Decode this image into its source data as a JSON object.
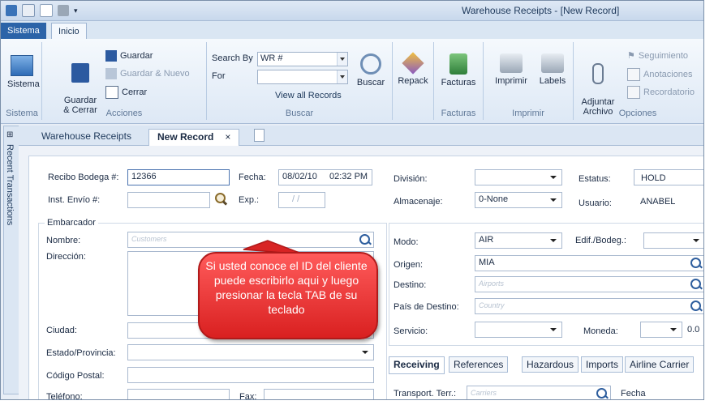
{
  "window": {
    "title": "Warehouse Receipts - [New Record]"
  },
  "ribbon_tabs": {
    "app": "Sistema",
    "home": "Inicio"
  },
  "ribbon": {
    "groups": {
      "sistema": {
        "label": "Sistema",
        "btn": "Sistema"
      },
      "acciones": {
        "label": "Acciones",
        "guardar_cerrar": "Guardar\n& Cerrar",
        "guardar": "Guardar",
        "guardar_nuevo": "Guardar & Nuevo",
        "cerrar": "Cerrar"
      },
      "buscar": {
        "label": "Buscar",
        "search_by_label": "Search By",
        "search_by_value": "WR #",
        "for_label": "For",
        "view_all": "View all Records",
        "buscar_btn": "Buscar"
      },
      "repack": {
        "btn": "Repack"
      },
      "facturas": {
        "label": "Facturas",
        "btn": "Facturas"
      },
      "imprimir": {
        "label": "Imprimir",
        "imprimir_btn": "Imprimir",
        "labels_btn": "Labels"
      },
      "opciones": {
        "label": "Opciones",
        "adjuntar": "Adjuntar\nArchivo",
        "seguimiento": "Seguimiento",
        "anotaciones": "Anotaciones",
        "recordatorio": "Recordatorio"
      }
    }
  },
  "sidebar": {
    "recent": "Recent Transactions"
  },
  "doc_tabs": {
    "warehouse": "Warehouse Receipts",
    "new_record": "New Record",
    "close": "×"
  },
  "form": {
    "recibo_label": "Recibo Bodega #:",
    "recibo_value": "12366",
    "fecha_label": "Fecha:",
    "fecha_date": "08/02/10",
    "fecha_time": "02:32 PM",
    "division_label": "División:",
    "estatus_label": "Estatus:",
    "estatus_value": "HOLD",
    "inst_label": "Inst. Envío #:",
    "exp_label": "Exp.:",
    "exp_value": "/ /",
    "almacenaje_label": "Almacenaje:",
    "almacenaje_value": "0-None",
    "usuario_label": "Usuario:",
    "usuario_value": "ANABEL",
    "embarcador_label": "Embarcador",
    "nombre_label": "Nombre:",
    "nombre_placeholder": "Customers",
    "direccion_label": "Dirección:",
    "ciudad_label": "Ciudad:",
    "estado_label": "Estado/Provincia:",
    "codigo_label": "Código Postal:",
    "telefono_label": "Teléfono:",
    "fax_label": "Fax:",
    "modo_label": "Modo:",
    "modo_value": "AIR",
    "edif_label": "Edif./Bodeg.:",
    "origen_label": "Origen:",
    "origen_value": "MIA",
    "destino_label": "Destino:",
    "destino_placeholder": "Airports",
    "pais_label": "País de Destino:",
    "pais_placeholder": "Country",
    "servicio_label": "Servicio:",
    "moneda_label": "Moneda:",
    "moneda_value": "0.0",
    "transport_label": "Transport. Terr.:",
    "transport_placeholder": "Carriers",
    "fecha2_label": "Fecha"
  },
  "section_tabs": [
    "Receiving",
    "References",
    "Hazardous",
    "Imports",
    "Airline Carrier"
  ],
  "callout": {
    "text": "Si usted conoce el ID del cliente puede escribirlo aqui y luego presionar la tecla TAB de su teclado"
  },
  "colors": {
    "accent": "#2b63a8",
    "callout": "#e02a2a"
  }
}
